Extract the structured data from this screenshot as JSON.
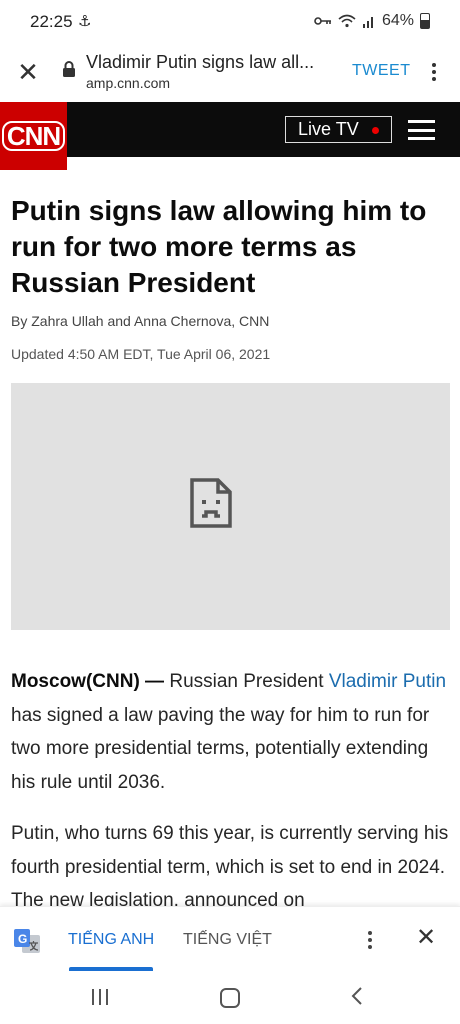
{
  "status_bar": {
    "time": "22:25",
    "battery": "64%"
  },
  "browser": {
    "close_icon": "close-icon",
    "page_title": "Vladimir Putin signs law all...",
    "url": "amp.cnn.com",
    "tweet_label": "TWEET"
  },
  "header": {
    "logo_text": "CNN",
    "live_tv_label": "Live TV",
    "brand_color": "#cc0000"
  },
  "article": {
    "headline": "Putin signs law allowing him to run for two more terms as Russian President",
    "byline": "By Zahra Ullah and Anna Chernova, CNN",
    "updated": "Updated 4:50 AM EDT, Tue April 06, 2021",
    "p1_dateline": "Moscow(CNN) —",
    "p1_before_link": " Russian President ",
    "p1_link": "Vladimir Putin",
    "p1_after_link": " has signed a law paving the way for him to run for two more presidential terms, potentially extending his rule until 2036.",
    "p2": "Putin, who turns 69 this year, is currently serving his fourth presidential term, which is set to end in 2024. The new legislation, announced on"
  },
  "translate_bar": {
    "tab_english": "TIẾNG ANH",
    "tab_vietnamese": "TIẾNG VIỆT",
    "active_color": "#1a6fd1"
  }
}
